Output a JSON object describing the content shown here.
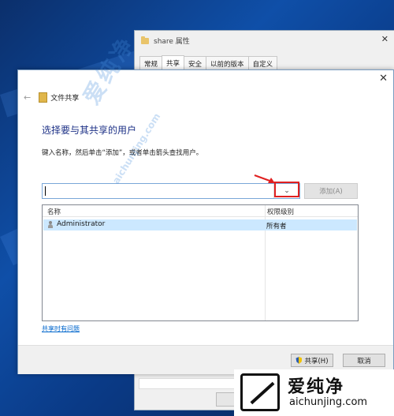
{
  "background_window": {
    "title": "share 属性",
    "tabs": [
      "常规",
      "共享",
      "安全",
      "以前的版本",
      "自定义"
    ],
    "active_tab": 1
  },
  "dialog": {
    "header_title": "文件共享",
    "heading": "选择要与其共享的用户",
    "instruction": "键入名称，然后单击“添加”，或者单击箭头查找用户。",
    "input_value": "",
    "add_button": "添加(A)",
    "columns": {
      "name": "名称",
      "permission": "权限级别"
    },
    "rows": [
      {
        "name": "Administrator",
        "permission": "所有者"
      }
    ],
    "help_link": "共享时有问题",
    "share_button": "共享(H)",
    "cancel_button": "取消"
  },
  "watermark": {
    "center_text": "爱纯净",
    "center_url": "aichunjing.com",
    "logo_cn": "爱纯净",
    "logo_en": "aichunjing.com"
  },
  "colors": {
    "heading": "#1e3287",
    "highlight": "#e02020",
    "selection": "#cce8ff"
  }
}
